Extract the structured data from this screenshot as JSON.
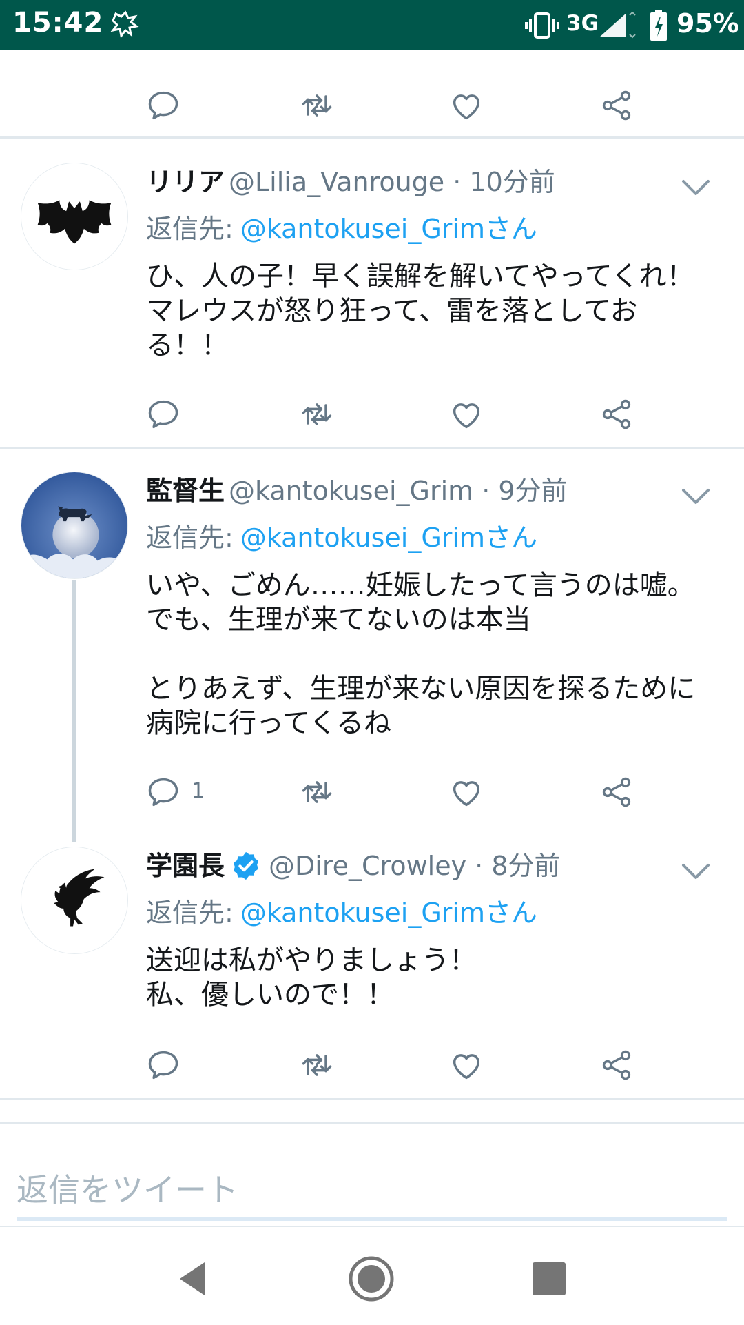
{
  "status_bar": {
    "time": "15:42",
    "network": "3G",
    "battery": "95%",
    "icons": [
      "notification-icon",
      "vibrate-icon",
      "signal-icon",
      "battery-charging-icon"
    ]
  },
  "tweets": [
    {
      "name": "リリア",
      "handle": "@Lilia_Vanrouge · 10分前",
      "reply_prefix": "返信先:",
      "reply_to": "@kantokusei_Grimさん",
      "body": "ひ、人の子！早く誤解を解いてやってくれ！\nマレウスが怒り狂って、雷を落としてお\nる！！",
      "reply_count": ""
    },
    {
      "name": "監督生",
      "handle": "@kantokusei_Grim · 9分前",
      "reply_prefix": "返信先:",
      "reply_to": "@kantokusei_Grimさん",
      "body": "いや、ごめん……妊娠したって言うのは嘘。\nでも、生理が来てないのは本当\n\nとりあえず、生理が来ない原因を探るために\n病院に行ってくるね",
      "reply_count": "1"
    },
    {
      "name": "学園長",
      "verified": true,
      "handle": "@Dire_Crowley · 8分前",
      "reply_prefix": "返信先:",
      "reply_to": "@kantokusei_Grimさん",
      "body": "送迎は私がやりましょう！\n私、優しいので！！",
      "reply_count": ""
    }
  ],
  "reply_input": {
    "placeholder": "返信をツイート"
  },
  "colors": {
    "status_bar": "#00574b",
    "accent": "#1da1f2",
    "secondary_text": "#657786",
    "icon": "#657786"
  },
  "nav_bar": {
    "buttons": [
      "back-icon",
      "home-icon",
      "recents-icon"
    ]
  }
}
